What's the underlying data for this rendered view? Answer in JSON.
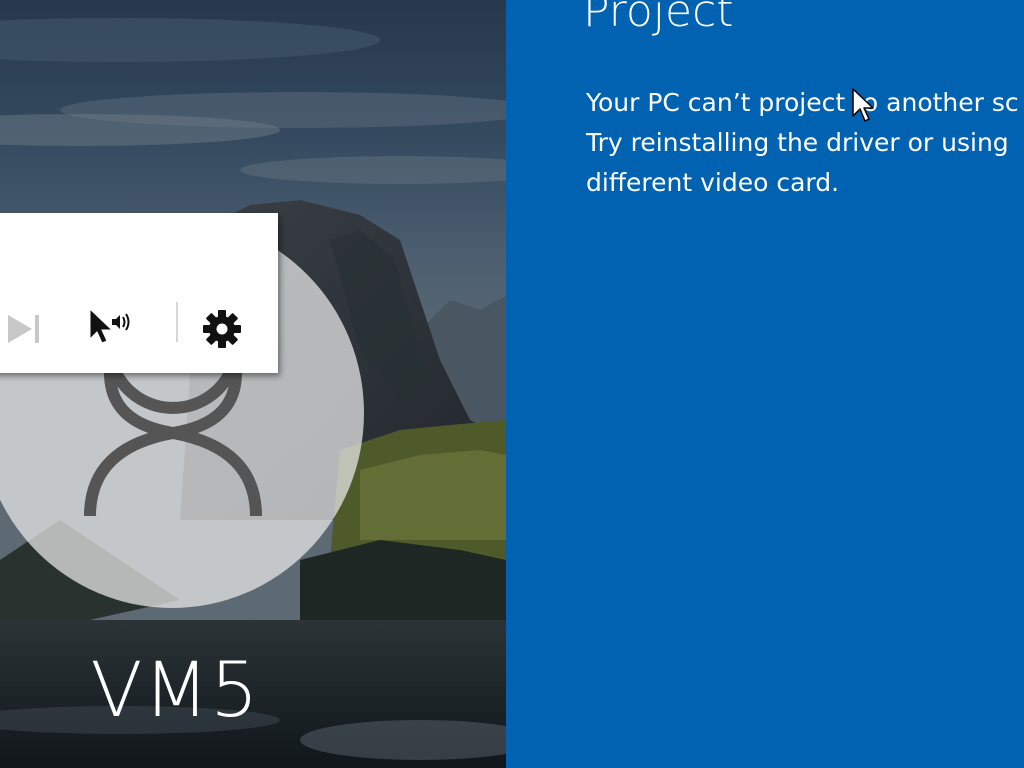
{
  "lock_screen": {
    "user_name": "VM5",
    "background": "mountain-lake-landscape",
    "avatar_icon": "user-silhouette-icon"
  },
  "vm_toolbar": {
    "buttons": [
      {
        "name": "next-icon",
        "enabled": false
      },
      {
        "name": "mouse-audio-icon",
        "enabled": true
      },
      {
        "name": "gear-icon",
        "enabled": true
      }
    ]
  },
  "project_panel": {
    "title": "Project",
    "message_lines": [
      "Your PC can’t project to another sc",
      "Try reinstalling the driver or using",
      "different video card."
    ]
  },
  "colors": {
    "panel_blue": "#0162b2",
    "text_white": "#ffffff",
    "toolbar_bg": "#ffffff",
    "avatar_fill": "#ebebeb"
  }
}
